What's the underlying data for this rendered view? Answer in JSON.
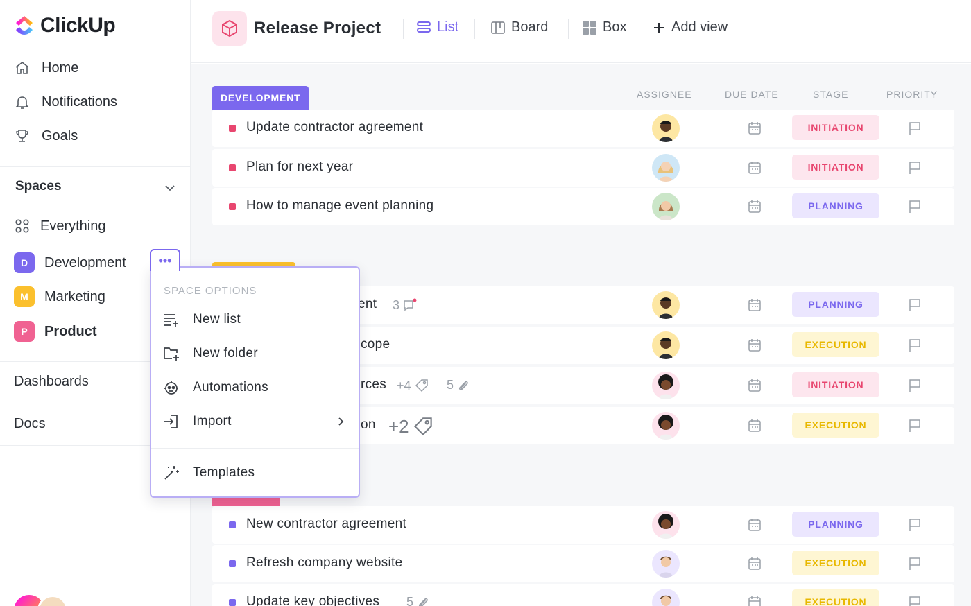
{
  "app": {
    "name": "ClickUp"
  },
  "sidebar": {
    "nav": [
      {
        "label": "Home",
        "icon": "home-icon"
      },
      {
        "label": "Notifications",
        "icon": "bell-icon"
      },
      {
        "label": "Goals",
        "icon": "trophy-icon"
      }
    ],
    "spaces_title": "Spaces",
    "everything_label": "Everything",
    "spaces": [
      {
        "initial": "D",
        "label": "Development",
        "color": "#7b68ee"
      },
      {
        "initial": "M",
        "label": "Marketing",
        "color": "#fbc02d"
      },
      {
        "initial": "P",
        "label": "Product",
        "color": "#f06292"
      }
    ],
    "dashboards_label": "Dashboards",
    "docs_label": "Docs"
  },
  "header": {
    "project_title": "Release Project",
    "views": [
      {
        "label": "List",
        "icon": "list-icon",
        "active": true
      },
      {
        "label": "Board",
        "icon": "board-icon",
        "active": false
      },
      {
        "label": "Box",
        "icon": "box-icon",
        "active": false
      },
      {
        "label": "Add view",
        "icon": "plus-icon",
        "active": false
      }
    ]
  },
  "columns": {
    "assignee": "ASSIGNEE",
    "due_date": "DUE DATE",
    "stage": "STAGE",
    "priority": "PRIORITY"
  },
  "groups": [
    {
      "label": "DEVELOPMENT",
      "color": "#7b68ee",
      "tasks": [
        {
          "name": "Update contractor agreement",
          "stage": "INITIATION",
          "dot": "#e8466f"
        },
        {
          "name": "Plan for next year",
          "stage": "INITIATION",
          "dot": "#e8466f"
        },
        {
          "name": "How to manage event planning",
          "stage": "PLANNING",
          "dot": "#e8466f"
        }
      ]
    },
    {
      "label": "",
      "color": "#fbc02d",
      "tasks": [
        {
          "name": "ent",
          "stage": "PLANNING",
          "meta": "3"
        },
        {
          "name": "cope",
          "stage": "EXECUTION"
        },
        {
          "name": "rces",
          "stage": "INITIATION",
          "meta_tags": "+4",
          "meta_attach": "5"
        },
        {
          "name": "on",
          "stage": "EXECUTION",
          "meta_tags": "+2"
        }
      ]
    },
    {
      "label": "",
      "color": "#f06292",
      "tasks": [
        {
          "name": "New contractor agreement",
          "stage": "PLANNING",
          "dot": "#7b68ee"
        },
        {
          "name": "Refresh company website",
          "stage": "EXECUTION",
          "dot": "#7b68ee"
        },
        {
          "name": "Update key objectives",
          "stage": "EXECUTION",
          "dot": "#7b68ee",
          "meta_attach": "5"
        }
      ]
    }
  ],
  "space_menu": {
    "title": "SPACE OPTIONS",
    "items": [
      {
        "label": "New list",
        "icon": "new-list-icon"
      },
      {
        "label": "New folder",
        "icon": "new-folder-icon"
      },
      {
        "label": "Automations",
        "icon": "robot-icon"
      },
      {
        "label": "Import",
        "icon": "import-icon"
      },
      {
        "label": "Templates",
        "icon": "magic-wand-icon"
      }
    ],
    "more_label": "•••"
  }
}
